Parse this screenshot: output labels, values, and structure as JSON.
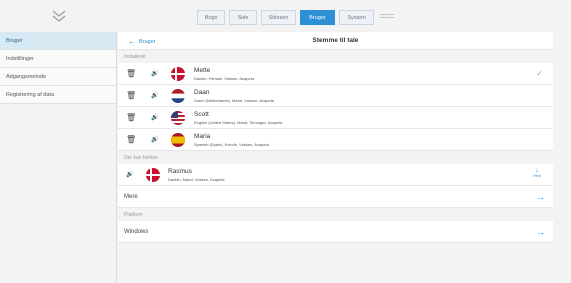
{
  "tabs": [
    {
      "label": "Bogs",
      "active": false
    },
    {
      "label": "Side",
      "active": false
    },
    {
      "label": "Sidesen",
      "active": false
    },
    {
      "label": "Bruger",
      "active": true
    },
    {
      "label": "System",
      "active": false
    }
  ],
  "sidebar": {
    "items": [
      {
        "label": "Bruger",
        "active": true
      },
      {
        "label": "Indstillinger",
        "active": false
      },
      {
        "label": "Adgangsmetode",
        "active": false
      },
      {
        "label": "Registrering af data",
        "active": false
      }
    ]
  },
  "header": {
    "back_label": "Bruger",
    "title": "Stemme til tale"
  },
  "installed": {
    "section_label": "Installeret",
    "voices": [
      {
        "name": "Mette",
        "desc": "Danish, Female, Voksen, Acapela",
        "flag": "dk",
        "selected": true
      },
      {
        "name": "Daan",
        "desc": "Dutch (Netherlands), Mand, Voksen, Acapela",
        "flag": "nl",
        "selected": false
      },
      {
        "name": "Scott",
        "desc": "English (United States), Mand, Teenager, Acapela",
        "flag": "us",
        "selected": false
      },
      {
        "name": "Maria",
        "desc": "Spanish (Spain), Kvinde, Voksen, Acapela",
        "flag": "es",
        "selected": false
      }
    ]
  },
  "available": {
    "section_label": "Der kan hentes",
    "voices": [
      {
        "name": "Rasmus",
        "desc": "Danish, Mand, Voksen, Acapela",
        "flag": "dk",
        "download_label": "Hent"
      }
    ],
    "more_label": "Mere"
  },
  "platform": {
    "section_label": "Platform",
    "item_label": "Windows"
  },
  "colors": {
    "accent": "#2d8fd6",
    "sidebar_active": "#d7e9f3"
  },
  "icons": {
    "trash": "trash-icon",
    "speaker": "speaker-icon",
    "check": "checkmark-icon",
    "download": "download-icon",
    "arrow": "arrow-right-icon"
  }
}
